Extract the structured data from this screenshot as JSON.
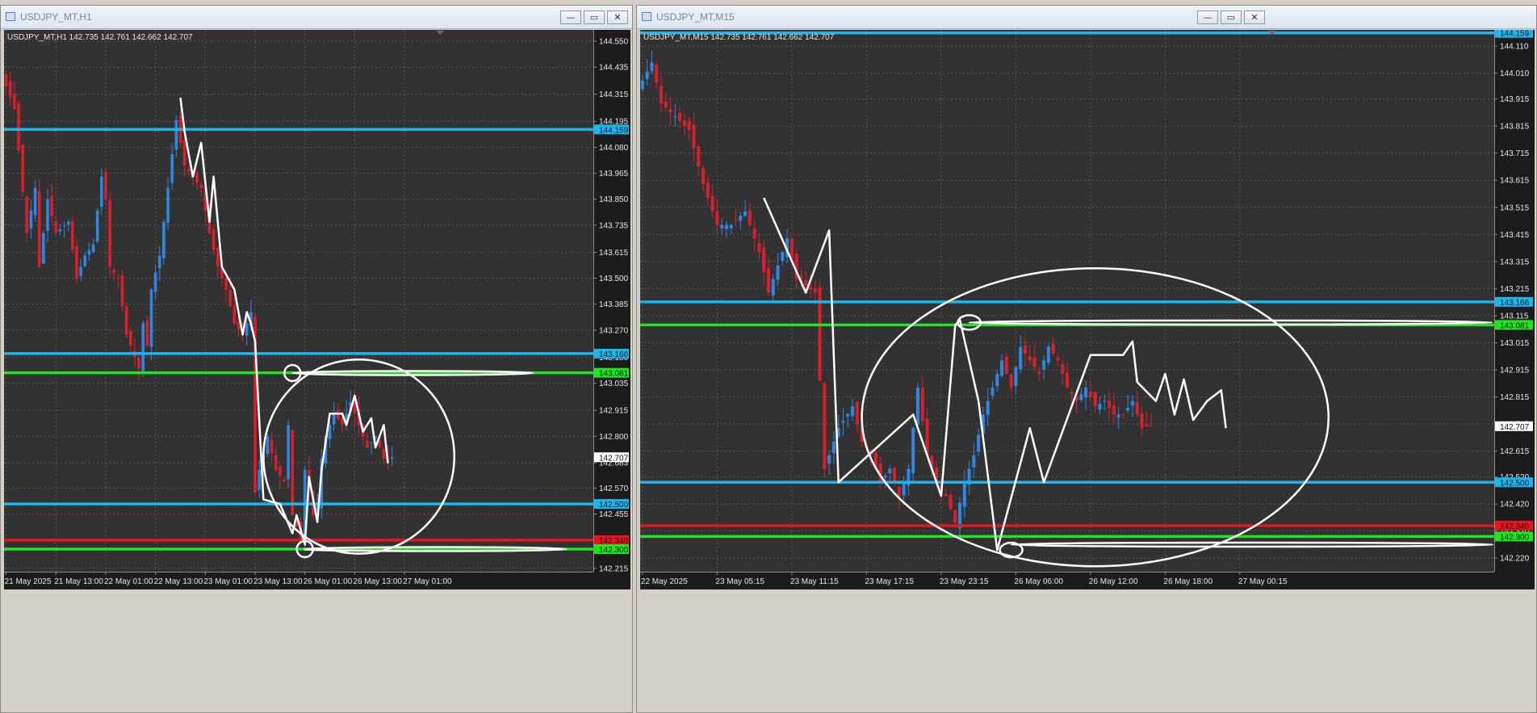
{
  "windows": [
    {
      "title": "USDJPY_MT,H1",
      "buttons": {
        "minimize": "—",
        "restore": "▭",
        "close": "✕"
      }
    },
    {
      "title": "USDJPY_MT,M15",
      "buttons": {
        "minimize": "—",
        "restore": "▭",
        "close": "✕"
      }
    }
  ],
  "colors": {
    "background": "#323232",
    "grid": "#555555",
    "bull": "#2f86e0",
    "bear": "#d8202a",
    "level_blue": "#1eb4f0",
    "level_green": "#1ee61e",
    "level_red": "#e8141e",
    "drawing": "#ffffff",
    "axis_text": "#e6e6e6"
  },
  "chart_data": [
    {
      "type": "candlestick",
      "symbol": "USDJPY_MT",
      "timeframe": "H1",
      "header": "USDJPY_MT,H1  142.735 142.761 142.662 142.707",
      "ylim": [
        142.2,
        144.6
      ],
      "y_ticks": [
        "144.550",
        "144.435",
        "144.315",
        "144.195",
        "144.080",
        "143.965",
        "143.850",
        "143.735",
        "143.615",
        "143.500",
        "143.385",
        "143.270",
        "143.150",
        "143.035",
        "142.915",
        "142.800",
        "142.683",
        "142.570",
        "142.455",
        "142.335",
        "142.215"
      ],
      "x_ticks": [
        {
          "label": "21 May 2025",
          "i": 0
        },
        {
          "label": "21 May 13:00",
          "i": 12
        },
        {
          "label": "22 May 01:00",
          "i": 24
        },
        {
          "label": "22 May 13:00",
          "i": 36
        },
        {
          "label": "23 May 01:00",
          "i": 48
        },
        {
          "label": "23 May 13:00",
          "i": 60
        },
        {
          "label": "26 May 01:00",
          "i": 72
        },
        {
          "label": "26 May 13:00",
          "i": 84
        },
        {
          "label": "27 May 01:00",
          "i": 96
        }
      ],
      "n_slots": 142,
      "current_price": {
        "value": 142.707,
        "label": "142.707"
      },
      "levels": [
        {
          "value": 144.159,
          "color": "blue",
          "label": "144.159"
        },
        {
          "value": 143.166,
          "color": "blue",
          "label": "143.166"
        },
        {
          "value": 143.081,
          "color": "green",
          "label": "143.081"
        },
        {
          "value": 142.5,
          "color": "blue",
          "label": "142.500"
        },
        {
          "value": 142.34,
          "color": "red",
          "label": "142.340"
        },
        {
          "value": 142.3,
          "color": "green",
          "label": "142.300"
        }
      ],
      "price_path": [
        [
          0,
          144.4
        ],
        [
          3,
          144.25
        ],
        [
          6,
          143.7
        ],
        [
          8,
          143.9
        ],
        [
          9,
          143.55
        ],
        [
          11,
          143.85
        ],
        [
          13,
          143.7
        ],
        [
          16,
          143.75
        ],
        [
          18,
          143.5
        ],
        [
          20,
          143.6
        ],
        [
          22,
          143.65
        ],
        [
          24,
          143.95
        ],
        [
          25,
          143.85
        ],
        [
          26,
          143.55
        ],
        [
          28,
          143.5
        ],
        [
          30,
          143.25
        ],
        [
          32,
          143.15
        ],
        [
          33,
          143.1
        ],
        [
          34,
          143.3
        ],
        [
          35,
          143.2
        ],
        [
          36,
          143.45
        ],
        [
          38,
          143.6
        ],
        [
          40,
          143.9
        ],
        [
          42,
          144.2
        ],
        [
          44,
          144.0
        ],
        [
          46,
          143.95
        ],
        [
          48,
          143.9
        ],
        [
          50,
          143.7
        ],
        [
          52,
          143.55
        ],
        [
          54,
          143.45
        ],
        [
          56,
          143.3
        ],
        [
          58,
          143.25
        ],
        [
          60,
          143.35
        ],
        [
          61,
          142.55
        ],
        [
          62,
          142.65
        ],
        [
          64,
          142.8
        ],
        [
          66,
          142.65
        ],
        [
          68,
          142.6
        ],
        [
          69,
          142.85
        ],
        [
          70,
          142.45
        ],
        [
          72,
          142.35
        ],
        [
          73,
          142.65
        ],
        [
          75,
          142.45
        ],
        [
          76,
          142.5
        ],
        [
          77,
          142.7
        ],
        [
          78,
          142.8
        ],
        [
          80,
          142.9
        ],
        [
          82,
          142.85
        ],
        [
          84,
          142.95
        ],
        [
          86,
          142.85
        ],
        [
          88,
          142.75
        ],
        [
          90,
          142.8
        ],
        [
          92,
          142.7
        ],
        [
          93,
          142.707
        ]
      ],
      "drawings": {
        "zigzag": [
          [
            42,
            144.3
          ],
          [
            43,
            144.15
          ],
          [
            45,
            143.95
          ],
          [
            47,
            144.1
          ],
          [
            49,
            143.75
          ],
          [
            50,
            143.95
          ],
          [
            51,
            143.75
          ],
          [
            52,
            143.55
          ],
          [
            55,
            143.45
          ],
          [
            57,
            143.25
          ],
          [
            58,
            143.35
          ],
          [
            59,
            143.3
          ],
          [
            60,
            143.22
          ],
          [
            62,
            142.52
          ],
          [
            66,
            142.5
          ],
          [
            69,
            142.37
          ],
          [
            70,
            142.45
          ],
          [
            72,
            142.32
          ],
          [
            73,
            142.62
          ],
          [
            75,
            142.42
          ],
          [
            76,
            142.65
          ],
          [
            78,
            142.9
          ],
          [
            81,
            142.9
          ],
          [
            82,
            142.85
          ],
          [
            84,
            142.98
          ],
          [
            86,
            142.82
          ],
          [
            88,
            142.88
          ],
          [
            89,
            142.75
          ],
          [
            91,
            142.85
          ],
          [
            92,
            142.68
          ]
        ],
        "ellipse": {
          "cx": 85,
          "cy": 142.71,
          "rx": 23,
          "ry": 0.43
        },
        "small_circles": [
          {
            "i": 69,
            "price": 143.08
          },
          {
            "i": 72,
            "price": 142.3
          }
        ],
        "horizontal_marks": [
          {
            "from": 69,
            "to": 127,
            "price": 143.08
          },
          {
            "from": 72,
            "to": 135,
            "price": 142.3
          }
        ]
      }
    },
    {
      "type": "candlestick",
      "symbol": "USDJPY_MT",
      "timeframe": "M15",
      "header": "USDJPY_MT,M15  142.735 142.761 142.662 142.707",
      "ylim": [
        142.17,
        144.17
      ],
      "y_ticks": [
        "144.110",
        "144.010",
        "143.915",
        "143.815",
        "143.715",
        "143.615",
        "143.515",
        "143.415",
        "143.315",
        "143.215",
        "143.115",
        "143.015",
        "142.915",
        "142.815",
        "142.715",
        "142.615",
        "142.520",
        "142.420",
        "142.320",
        "142.220"
      ],
      "x_ticks": [
        {
          "label": "22 May 2025",
          "i": 0
        },
        {
          "label": "23 May 05:15",
          "i": 16
        },
        {
          "label": "23 May 11:15",
          "i": 32
        },
        {
          "label": "23 May 17:15",
          "i": 48
        },
        {
          "label": "23 May 23:15",
          "i": 64
        },
        {
          "label": "26 May 06:00",
          "i": 80
        },
        {
          "label": "26 May 12:00",
          "i": 96
        },
        {
          "label": "26 May 18:00",
          "i": 112
        },
        {
          "label": "27 May 00:15",
          "i": 128
        }
      ],
      "n_slots": 183,
      "current_price": {
        "value": 142.707,
        "label": "142.707"
      },
      "levels": [
        {
          "value": 144.159,
          "color": "blue",
          "label": "144.159"
        },
        {
          "value": 143.166,
          "color": "blue",
          "label": "143.166"
        },
        {
          "value": 143.081,
          "color": "green",
          "label": "143.081"
        },
        {
          "value": 142.5,
          "color": "blue",
          "label": "142.500"
        },
        {
          "value": 142.34,
          "color": "red",
          "label": "142.340"
        },
        {
          "value": 142.3,
          "color": "green",
          "label": "142.300"
        }
      ],
      "price_path": [
        [
          0,
          143.95
        ],
        [
          3,
          144.05
        ],
        [
          5,
          143.9
        ],
        [
          8,
          143.85
        ],
        [
          11,
          143.8
        ],
        [
          14,
          143.6
        ],
        [
          17,
          143.45
        ],
        [
          20,
          143.45
        ],
        [
          23,
          143.5
        ],
        [
          26,
          143.35
        ],
        [
          28,
          143.2
        ],
        [
          30,
          143.3
        ],
        [
          32,
          143.4
        ],
        [
          34,
          143.25
        ],
        [
          38,
          143.2
        ],
        [
          40,
          142.55
        ],
        [
          43,
          142.7
        ],
        [
          46,
          142.78
        ],
        [
          48,
          142.65
        ],
        [
          50,
          142.6
        ],
        [
          52,
          142.5
        ],
        [
          54,
          142.55
        ],
        [
          56,
          142.45
        ],
        [
          58,
          142.55
        ],
        [
          60,
          142.85
        ],
        [
          62,
          142.6
        ],
        [
          64,
          142.5
        ],
        [
          66,
          142.45
        ],
        [
          68,
          142.35
        ],
        [
          70,
          142.5
        ],
        [
          72,
          142.6
        ],
        [
          74,
          142.75
        ],
        [
          76,
          142.85
        ],
        [
          78,
          142.95
        ],
        [
          80,
          142.85
        ],
        [
          82,
          143.0
        ],
        [
          84,
          142.95
        ],
        [
          86,
          142.9
        ],
        [
          88,
          143.0
        ],
        [
          90,
          142.95
        ],
        [
          92,
          142.85
        ],
        [
          94,
          142.8
        ],
        [
          96,
          142.85
        ],
        [
          98,
          142.78
        ],
        [
          100,
          142.8
        ],
        [
          102,
          142.75
        ],
        [
          104,
          142.75
        ],
        [
          106,
          142.8
        ],
        [
          108,
          142.7
        ],
        [
          109,
          142.707
        ]
      ],
      "drawings": {
        "zigzag": [
          [
            26,
            143.55
          ],
          [
            35,
            143.2
          ],
          [
            40,
            143.43
          ],
          [
            42,
            142.5
          ],
          [
            58,
            142.75
          ],
          [
            64,
            142.45
          ],
          [
            67,
            143.08
          ],
          [
            68,
            143.1
          ],
          [
            72,
            142.8
          ],
          [
            76,
            142.25
          ],
          [
            83,
            142.7
          ],
          [
            86,
            142.5
          ],
          [
            96,
            142.97
          ],
          [
            103,
            142.97
          ],
          [
            105,
            143.02
          ],
          [
            106,
            142.87
          ],
          [
            110,
            142.8
          ],
          [
            112,
            142.9
          ],
          [
            114,
            142.75
          ],
          [
            116,
            142.88
          ],
          [
            118,
            142.73
          ],
          [
            121,
            142.8
          ],
          [
            124,
            142.84
          ],
          [
            125,
            142.7
          ]
        ],
        "ellipse": {
          "cx": 97,
          "cy": 142.74,
          "rx": 50,
          "ry": 0.55
        },
        "small_circles": [
          {
            "i": 70,
            "price": 143.09
          },
          {
            "i": 79,
            "price": 142.25
          }
        ],
        "horizontal_marks": [
          {
            "from": 70,
            "to": 182,
            "price": 143.09
          },
          {
            "from": 79,
            "to": 190,
            "price": 142.27
          }
        ]
      }
    }
  ]
}
